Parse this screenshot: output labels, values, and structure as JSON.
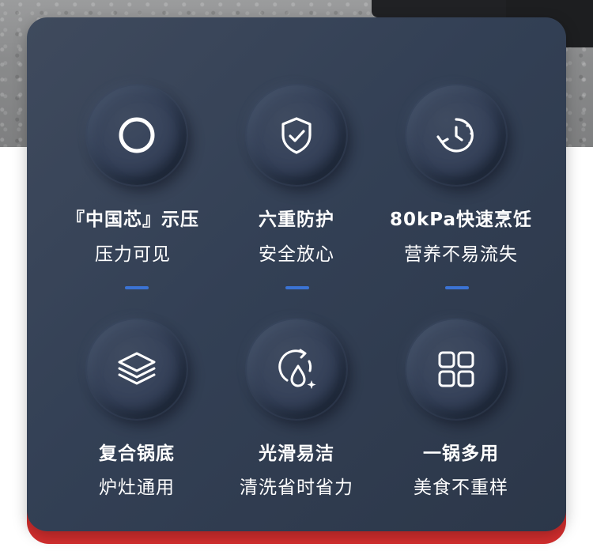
{
  "colors": {
    "panel": "#344055",
    "accent_dash": "#3b73d4",
    "red_base": "#d42e2e",
    "text": "#ffffff"
  },
  "features": [
    {
      "icon": "ring-icon",
      "title": "『中国芯』示压",
      "subtitle": "压力可见"
    },
    {
      "icon": "shield-check-icon",
      "title": "六重防护",
      "subtitle": "安全放心"
    },
    {
      "icon": "clock-arrow-icon",
      "title": "80kPa快速烹饪",
      "subtitle": "营养不易流失"
    },
    {
      "icon": "layers-icon",
      "title": "复合锅底",
      "subtitle": "炉灶通用"
    },
    {
      "icon": "water-drop-cycle-icon",
      "title": "光滑易洁",
      "subtitle": "清洗省时省力"
    },
    {
      "icon": "grid-squares-icon",
      "title": "一锅多用",
      "subtitle": "美食不重样"
    }
  ]
}
